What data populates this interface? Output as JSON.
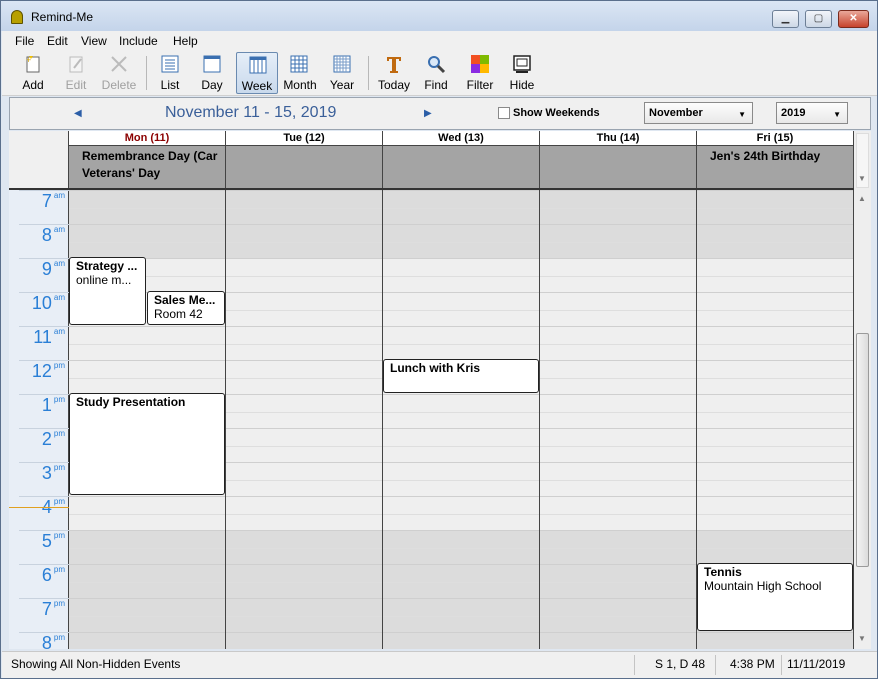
{
  "window": {
    "title": "Remind-Me"
  },
  "menu": [
    "File",
    "Edit",
    "View",
    "Include",
    "Help"
  ],
  "toolbar": {
    "add": "Add",
    "edit": "Edit",
    "delete": "Delete",
    "list": "List",
    "day": "Day",
    "week": "Week",
    "month": "Month",
    "year": "Year",
    "today": "Today",
    "find": "Find",
    "filter": "Filter",
    "hide": "Hide"
  },
  "nav": {
    "range": "November 11 - 15, 2019",
    "show_weekends": "Show Weekends",
    "month_value": "November",
    "year_value": "2019"
  },
  "days": [
    {
      "label": "Mon (11)",
      "color": "#8b0000"
    },
    {
      "label": "Tue (12)",
      "color": "#000000"
    },
    {
      "label": "Wed (13)",
      "color": "#000000"
    },
    {
      "label": "Thu (14)",
      "color": "#000000"
    },
    {
      "label": "Fri (15)",
      "color": "#000000"
    }
  ],
  "allday": {
    "mon_line1": "Remembrance Day (Car",
    "mon_line2": "Veterans' Day",
    "fri": "Jen's 24th Birthday"
  },
  "hours": [
    {
      "h": "7",
      "ap": "am"
    },
    {
      "h": "8",
      "ap": "am"
    },
    {
      "h": "9",
      "ap": "am"
    },
    {
      "h": "10",
      "ap": "am"
    },
    {
      "h": "11",
      "ap": "am"
    },
    {
      "h": "12",
      "ap": "pm"
    },
    {
      "h": "1",
      "ap": "pm"
    },
    {
      "h": "2",
      "ap": "pm"
    },
    {
      "h": "3",
      "ap": "pm"
    },
    {
      "h": "4",
      "ap": "pm"
    },
    {
      "h": "5",
      "ap": "pm"
    },
    {
      "h": "6",
      "ap": "pm"
    },
    {
      "h": "7",
      "ap": "pm"
    },
    {
      "h": "8",
      "ap": "pm"
    }
  ],
  "events": {
    "strategy": {
      "title": "Strategy ...",
      "sub": "online m..."
    },
    "sales": {
      "title": "Sales Me...",
      "sub": "Room 42"
    },
    "study": {
      "title": "Study Presentation"
    },
    "lunch": {
      "title": "Lunch with Kris"
    },
    "tennis": {
      "title": "Tennis",
      "sub": "Mountain High School"
    }
  },
  "status": {
    "text": "Showing All Non-Hidden Events",
    "count": "S 1, D 48",
    "time": "4:38 PM",
    "date": "11/11/2019"
  },
  "colors": {
    "hour_label": "#2a7fd6",
    "allday_bg": "#a4a4a4",
    "range_title": "#3a5f99",
    "today_marker": "#e0a020"
  }
}
